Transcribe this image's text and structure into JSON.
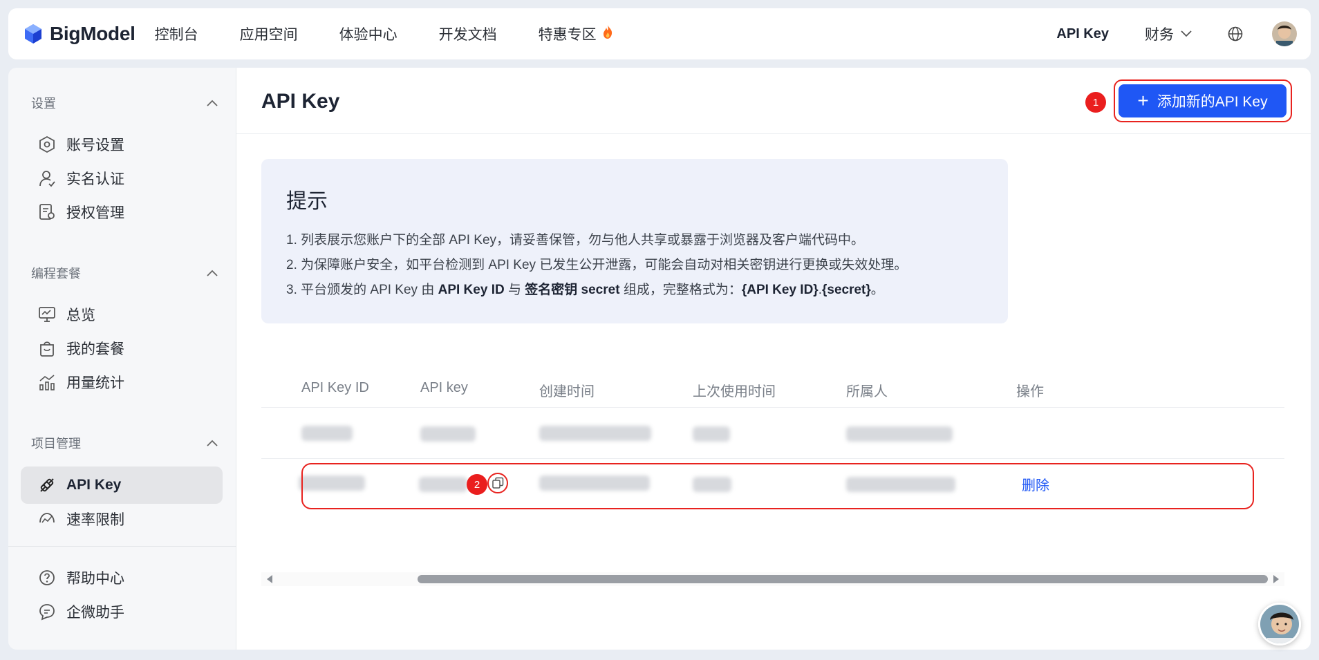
{
  "brand": {
    "name": "BigModel"
  },
  "nav": {
    "items": [
      {
        "label": "控制台"
      },
      {
        "label": "应用空间"
      },
      {
        "label": "体验中心"
      },
      {
        "label": "开发文档"
      },
      {
        "label": "特惠专区"
      }
    ],
    "right": {
      "api_key": "API Key",
      "finance": "财务"
    }
  },
  "sidebar": {
    "groups": [
      {
        "label": "设置",
        "items": [
          {
            "label": "账号设置",
            "icon": "account-settings-icon"
          },
          {
            "label": "实名认证",
            "icon": "user-verify-icon"
          },
          {
            "label": "授权管理",
            "icon": "authorization-icon"
          }
        ]
      },
      {
        "label": "编程套餐",
        "items": [
          {
            "label": "总览",
            "icon": "monitor-icon"
          },
          {
            "label": "我的套餐",
            "icon": "package-icon"
          },
          {
            "label": "用量统计",
            "icon": "usage-chart-icon"
          }
        ]
      },
      {
        "label": "项目管理",
        "items": [
          {
            "label": "API Key",
            "icon": "api-key-icon"
          },
          {
            "label": "速率限制",
            "icon": "rate-limit-icon"
          }
        ]
      }
    ],
    "bottom": [
      {
        "label": "帮助中心",
        "icon": "help-icon"
      },
      {
        "label": "企微助手",
        "icon": "chat-icon"
      }
    ]
  },
  "main": {
    "title": "API Key",
    "add_button": "添加新的API Key",
    "tip": {
      "title": "提示",
      "line1": "1. 列表展示您账户下的全部 API Key，请妥善保管，勿与他人共享或暴露于浏览器及客户端代码中。",
      "line2": "2. 为保障账户安全，如平台检测到 API Key 已发生公开泄露，可能会自动对相关密钥进行更换或失效处理。",
      "line3_a": "3. 平台颁发的 API Key 由 ",
      "line3_b": "API Key ID",
      "line3_c": " 与 ",
      "line3_d": "签名密钥 secret",
      "line3_e": " 组成，完整格式为：",
      "line3_f": "{API Key ID}",
      "line3_g": ".",
      "line3_h": "{secret}",
      "line3_i": "。"
    },
    "table": {
      "columns": [
        "API Key ID",
        "API key",
        "创建时间",
        "上次使用时间",
        "所属人",
        "操作"
      ],
      "rows": [
        {
          "action": ""
        },
        {
          "action": "删除"
        }
      ]
    },
    "annotations": [
      "1",
      "2"
    ]
  },
  "colors": {
    "primary": "#1f57f5",
    "highlight": "#e8231f",
    "tip_bg": "#eef1fa"
  }
}
